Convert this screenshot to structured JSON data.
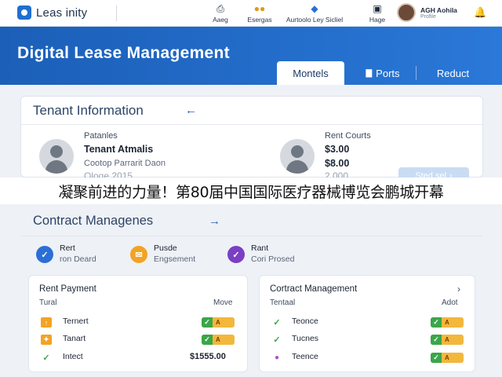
{
  "app": {
    "name": "Leas inity"
  },
  "topnav": [
    {
      "label": "Aaeg",
      "icon": "printer-icon"
    },
    {
      "label": "Esergas",
      "icon": "people-icon"
    },
    {
      "label": "Aurtoolo Ley Sicliel",
      "icon": "key-icon"
    },
    {
      "label": "Hage",
      "icon": "document-icon"
    }
  ],
  "user": {
    "name": "AGH Aohila",
    "role": "Profile"
  },
  "banner": {
    "title": "Digital Lease Management"
  },
  "tabs": [
    {
      "label": "Montels"
    },
    {
      "label": "Ports"
    },
    {
      "label": "Reduct"
    }
  ],
  "tenant": {
    "title": "Tenant Information",
    "label": "Patanles",
    "name": "Tenant Atmalis",
    "line1": "Cootop Parrarit Daon",
    "line2": "Oloqe 2015",
    "rent_label": "Rent Courts",
    "values": [
      "$3.00",
      "$8.00",
      "2.000"
    ],
    "button": "Sted sel"
  },
  "headline": "凝聚前进的力量！第80届中国国际医疗器械博览会鹏城开幕",
  "contract": {
    "title": "Contract Managenes",
    "features": [
      {
        "t1": "Rert",
        "t2": "ron Deard",
        "color": "#2b6fd6"
      },
      {
        "t1": "Pusde",
        "t2": "Engsement",
        "color": "#f2a324"
      },
      {
        "t1": "Rant",
        "t2": "Cori Prosed",
        "color": "#7a3fc4"
      }
    ]
  },
  "rent_payment": {
    "title": "Rent Payment",
    "col1": "Tural",
    "col2": "Move",
    "rows": [
      {
        "label": "Ternert",
        "status": "A"
      },
      {
        "label": "Tanart",
        "status": "A"
      },
      {
        "label": "Intect",
        "amount": "$1555.00"
      }
    ]
  },
  "contract_mgmt": {
    "title": "Cortract Management",
    "col1": "Tentaal",
    "col2": "Adot",
    "rows": [
      {
        "label": "Teonce",
        "status": "A"
      },
      {
        "label": "Tucnes",
        "status": "A"
      },
      {
        "label": "Teence",
        "status": "A"
      }
    ]
  },
  "colors": {
    "brand": "#1f6fd1",
    "banner": "#1b5fb8",
    "check": "#3aa64a",
    "badge": "#f3b73c"
  }
}
